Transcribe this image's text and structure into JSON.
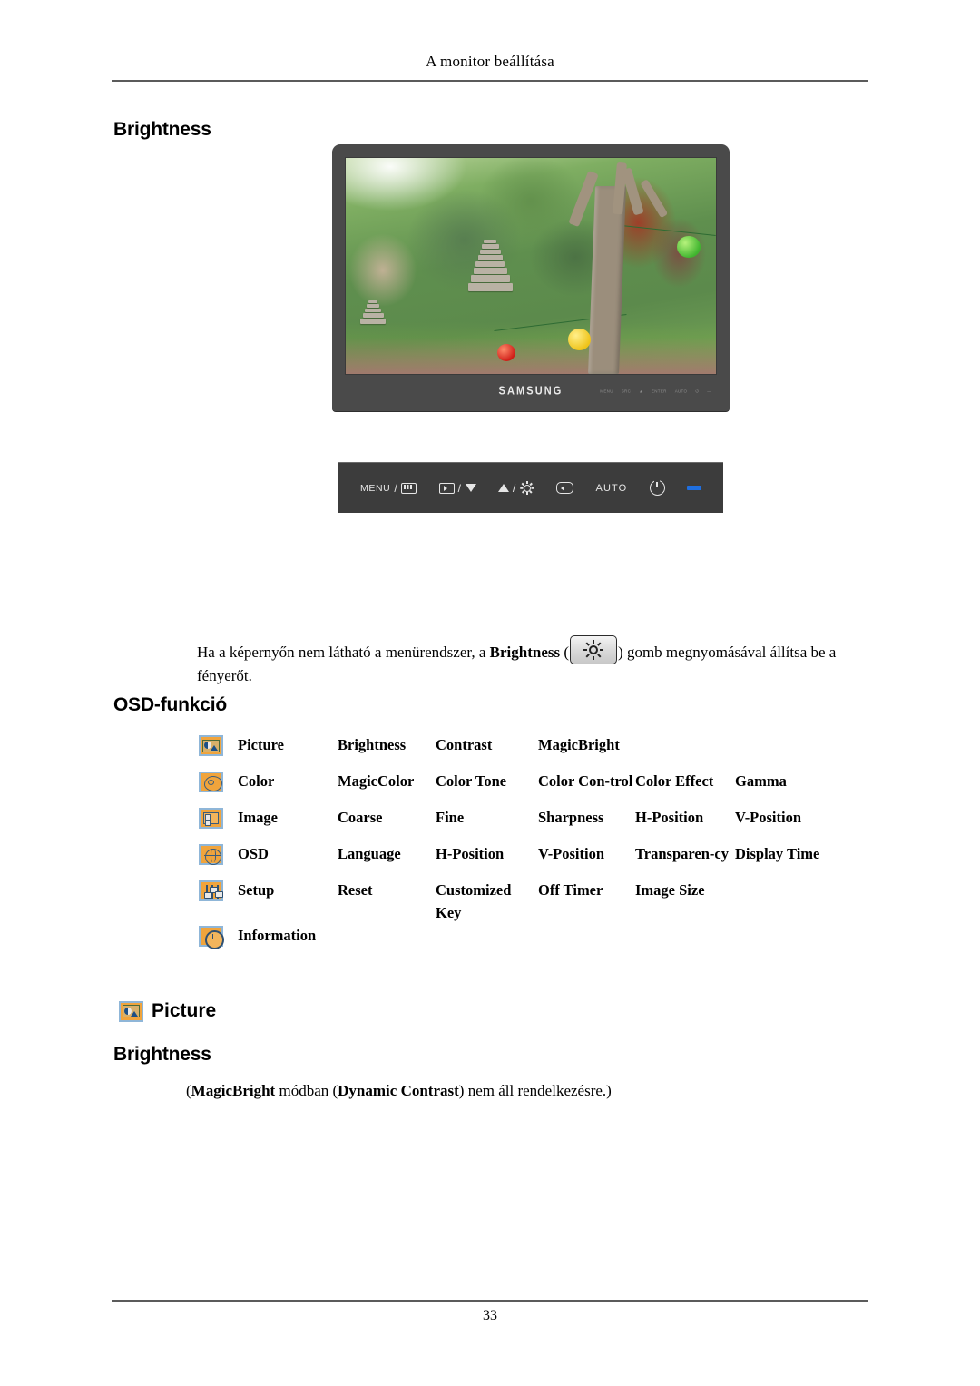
{
  "header": {
    "running_title": "A monitor beállítása"
  },
  "sections": {
    "brightness_heading": "Brightness",
    "osd_function_heading": "OSD-funkció",
    "picture_heading": "Picture",
    "brightness_heading_2": "Brightness"
  },
  "monitor": {
    "brand_logo": "SAMSUNG",
    "bezel_keys": [
      "MENU",
      "SRC",
      "▲",
      "ENTER",
      "AUTO",
      "⏻",
      "—"
    ]
  },
  "control_panel": {
    "buttons": [
      {
        "label": "MENU",
        "separator": "/",
        "icon": "menu-bars-icon"
      },
      {
        "label": "",
        "separator": "/",
        "icon": "source-icon",
        "icon2": "triangle-down-icon"
      },
      {
        "label": "",
        "separator": "/",
        "icon": "triangle-up-icon",
        "icon2": "brightness-sun-icon"
      },
      {
        "label": "",
        "separator": "",
        "icon": "enter-icon"
      },
      {
        "label": "AUTO",
        "separator": "",
        "icon": ""
      },
      {
        "label": "",
        "separator": "",
        "icon": "power-icon"
      },
      {
        "label": "",
        "separator": "",
        "icon": "power-led-indicator"
      }
    ],
    "led_color": "#1f6fe0"
  },
  "body_paragraph": {
    "part1": "Ha a képernyőn nem látható a menürendszer, a ",
    "bold1": "Brightness",
    "part2": " (",
    "inline_icon": "brightness-sun-button-icon",
    "part3": ") gomb megnyomásával állítsa be a fényerőt."
  },
  "osd_table": {
    "rows": [
      {
        "icon": "picture-icon",
        "name": "Picture",
        "items": [
          "Brightness",
          "Contrast",
          "MagicBright",
          "",
          ""
        ]
      },
      {
        "icon": "color-icon",
        "name": "Color",
        "items": [
          "MagicColor",
          "Color Tone",
          "Color Con-trol",
          "Color Effect",
          "Gamma"
        ]
      },
      {
        "icon": "image-icon",
        "name": "Image",
        "items": [
          "Coarse",
          "Fine",
          "Sharpness",
          "H-Position",
          "V-Position"
        ]
      },
      {
        "icon": "osd-icon",
        "name": "OSD",
        "items": [
          "Language",
          "H-Position",
          "V-Position",
          "Transparen-cy",
          "Display Time"
        ]
      },
      {
        "icon": "setup-icon",
        "name": "Setup",
        "items": [
          "Reset",
          "Customized Key",
          "Off Timer",
          "Image Size",
          ""
        ]
      },
      {
        "icon": "information-icon",
        "name": "Information",
        "items": [
          "",
          "",
          "",
          "",
          ""
        ]
      }
    ]
  },
  "note": {
    "open_paren": "(",
    "bold1": "MagicBright",
    "mid1": " módban (",
    "bold2": "Dynamic Contrast",
    "mid2": ") nem áll rendelkezésre.)"
  },
  "footer": {
    "page_number": "33"
  },
  "colors": {
    "icon_fill": "#f0a43c",
    "icon_border": "#8fb6d8",
    "rule": "#5b5b5b",
    "led_blue": "#1f6fe0",
    "bezel": "#4a4a4a"
  }
}
